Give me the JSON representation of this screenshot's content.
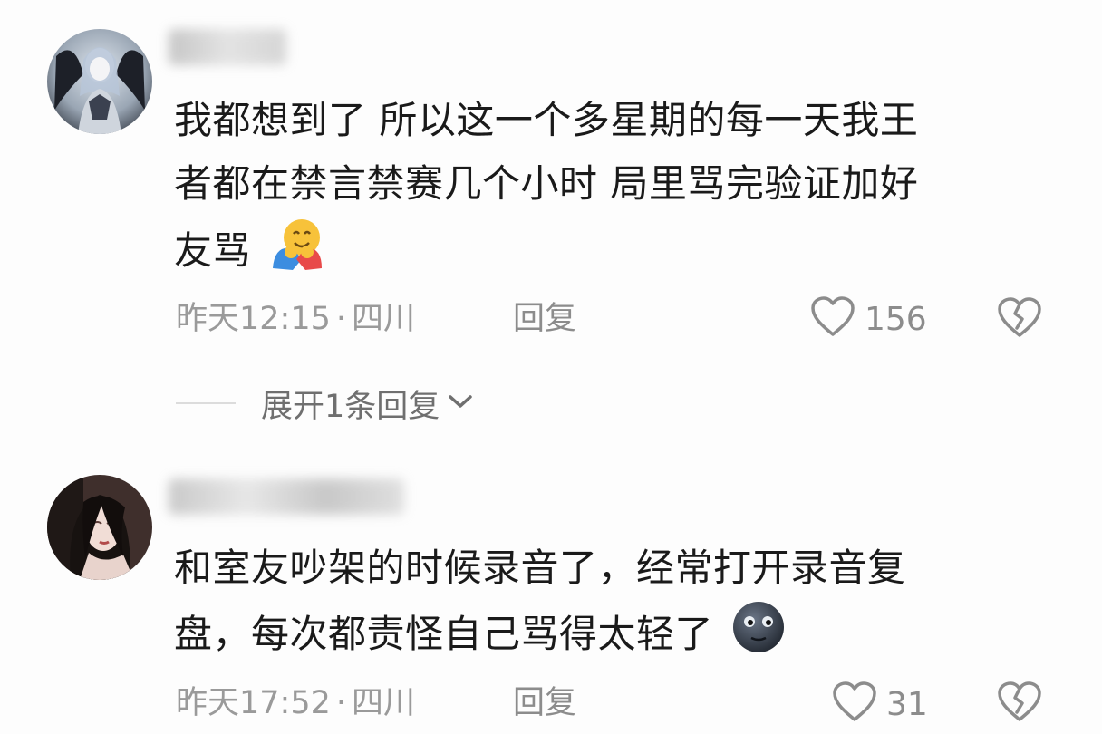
{
  "comments": [
    {
      "avatar": "dark-fantasy-character-avatar",
      "text_line1": "我都想到了  所以这一个多星期的每一天我王",
      "text_line2": "者都在禁言禁赛几个小时 局里骂完验证加好",
      "text_line3": "友骂",
      "emoji": "hugging-face-emoji",
      "time": "昨天12:15",
      "dot": "·",
      "location": "四川",
      "reply_label": "回复",
      "like_count": "156",
      "expand_label": "展开1条回复"
    },
    {
      "avatar": "anime-girl-avatar",
      "text_line1": "和室友吵架的时候录音了，经常打开录音复",
      "text_line2": "盘，每次都责怪自己骂得太轻了",
      "emoji": "new-moon-face-emoji",
      "time": "昨天17:52",
      "dot": "·",
      "location": "四川",
      "reply_label": "回复",
      "like_count": "31"
    }
  ],
  "colors": {
    "background": "#fdfdfd",
    "text": "#1a1a1a",
    "meta": "#9a9a9a",
    "icon": "#8c8c8c"
  }
}
